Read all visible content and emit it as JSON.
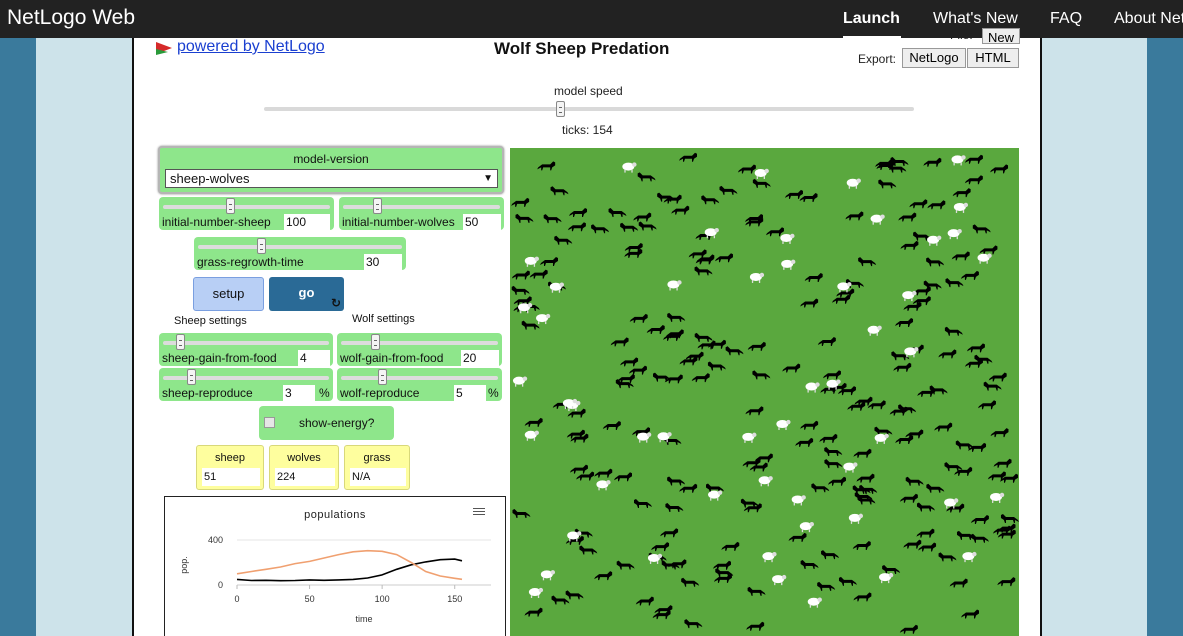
{
  "app": {
    "brand": "NetLogo Web",
    "nav": [
      {
        "label": "Launch",
        "active": true
      },
      {
        "label": "What's New",
        "active": false
      },
      {
        "label": "FAQ",
        "active": false
      },
      {
        "label": "About Net",
        "active": false
      }
    ]
  },
  "header": {
    "powered_by": "powered by NetLogo",
    "model_title": "Wolf Sheep Predation",
    "file_label": "File:",
    "file_new": "New",
    "export_label": "Export:",
    "export_netlogo": "NetLogo",
    "export_html": "HTML"
  },
  "speed": {
    "label": "model speed",
    "ticks_label": "ticks: 154"
  },
  "model_version": {
    "label": "model-version",
    "selected": "sheep-wolves"
  },
  "sliders": {
    "initial_number_sheep": {
      "label": "initial-number-sheep",
      "value": "100",
      "fraction": 0.4
    },
    "initial_number_wolves": {
      "label": "initial-number-wolves",
      "value": "50",
      "fraction": 0.2
    },
    "grass_regrowth_time": {
      "label": "grass-regrowth-time",
      "value": "30",
      "fraction": 0.3
    },
    "sheep_gain_from_food": {
      "label": "sheep-gain-from-food",
      "value": "4",
      "fraction": 0.08
    },
    "wolf_gain_from_food": {
      "label": "wolf-gain-from-food",
      "value": "20",
      "fraction": 0.2
    },
    "sheep_reproduce": {
      "label": "sheep-reproduce",
      "value": "3",
      "unit": "%",
      "fraction": 0.15
    },
    "wolf_reproduce": {
      "label": "wolf-reproduce",
      "value": "5",
      "unit": "%",
      "fraction": 0.25
    }
  },
  "buttons": {
    "setup": "setup",
    "go": "go"
  },
  "sections": {
    "sheep": "Sheep settings",
    "wolf": "Wolf settings"
  },
  "switch": {
    "label": "show-energy?",
    "on": false
  },
  "monitors": [
    {
      "label": "sheep",
      "value": "51"
    },
    {
      "label": "wolves",
      "value": "224"
    },
    {
      "label": "grass",
      "value": "N/A"
    }
  ],
  "colors": {
    "green_widget": "#8ee68b",
    "world_green": "#5aa83e",
    "monitor_yellow": "#fefe9e",
    "go_blue": "#2a6a96",
    "wolf": "#000000",
    "sheep": "#ffffff",
    "plot_sheep": "#f0a070"
  },
  "chart_data": {
    "type": "line",
    "title": "populations",
    "xlabel": "time",
    "ylabel": "pop.",
    "xlim": [
      0,
      175
    ],
    "ylim": [
      0,
      400
    ],
    "xticks": [
      "0",
      "50",
      "100",
      "150"
    ],
    "yticks": [
      "0",
      "400"
    ],
    "series": [
      {
        "color": "#000000",
        "x": [
          0,
          10,
          20,
          30,
          40,
          50,
          60,
          70,
          80,
          90,
          100,
          110,
          120,
          130,
          140,
          150,
          155
        ],
        "y": [
          50,
          40,
          42,
          38,
          40,
          45,
          42,
          45,
          50,
          62,
          90,
          140,
          180,
          205,
          225,
          230,
          215
        ]
      },
      {
        "color": "#f0a070",
        "x": [
          0,
          10,
          20,
          30,
          40,
          50,
          60,
          70,
          80,
          90,
          100,
          110,
          120,
          130,
          140,
          150,
          155
        ],
        "y": [
          100,
          120,
          140,
          160,
          190,
          210,
          240,
          270,
          295,
          305,
          300,
          270,
          200,
          120,
          80,
          60,
          51
        ]
      }
    ]
  }
}
